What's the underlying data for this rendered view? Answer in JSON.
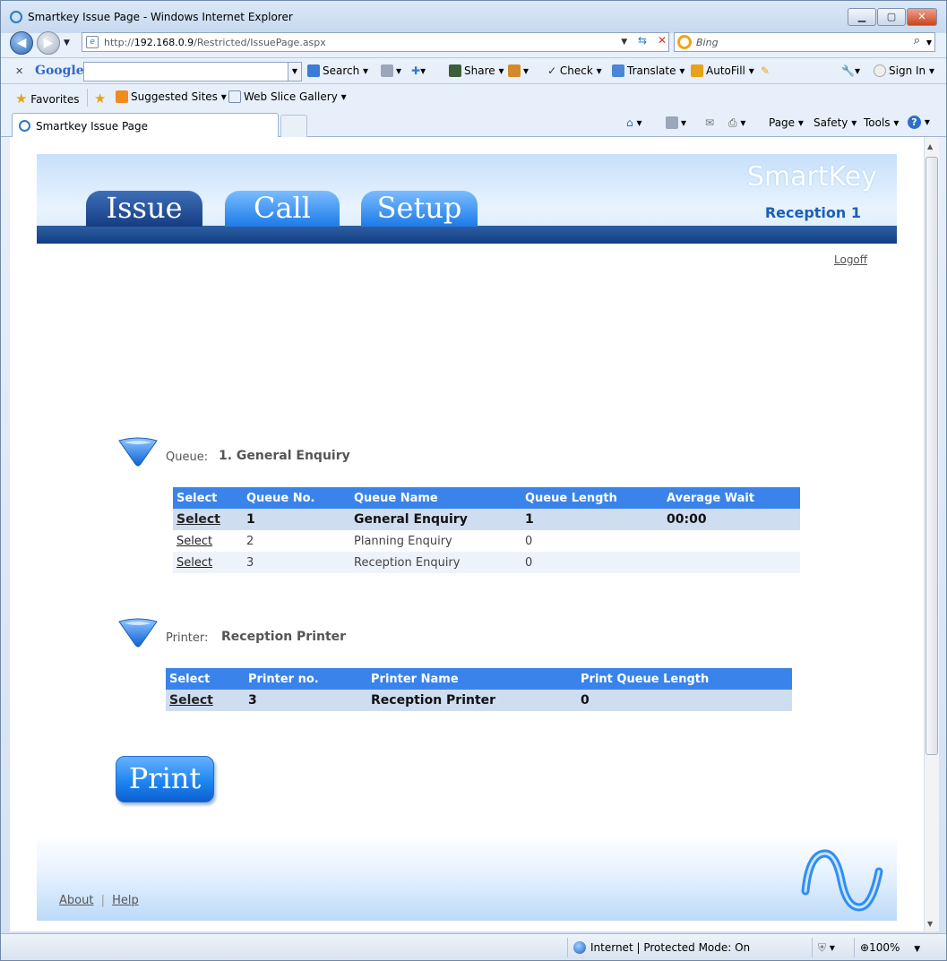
{
  "browser": {
    "window_title": "Smartkey Issue Page - Windows Internet Explorer",
    "url_prefix": "http://",
    "url_host": "192.168.0.9",
    "url_path": "/Restricted/IssuePage.aspx",
    "search_placeholder": "Bing",
    "tab_title": "Smartkey Issue Page",
    "google_toolbar": {
      "logo": "Google",
      "search": "Search",
      "share": "Share",
      "check": "Check",
      "translate": "Translate",
      "autofill": "AutoFill",
      "sign_in": "Sign In"
    },
    "favorites_bar": {
      "favorites": "Favorites",
      "suggested_sites": "Suggested Sites",
      "web_slice_gallery": "Web Slice Gallery"
    },
    "command_bar": {
      "page": "Page",
      "safety": "Safety",
      "tools": "Tools"
    },
    "status": {
      "zone": "Internet | Protected Mode: On",
      "zoom": "100%"
    }
  },
  "app": {
    "brand": "SmartKey",
    "location": "Reception 1",
    "tabs": [
      {
        "label": "Issue",
        "active": true
      },
      {
        "label": "Call",
        "active": false
      },
      {
        "label": "Setup",
        "active": false
      }
    ],
    "logoff": "Logoff",
    "queue_section": {
      "label": "Queue:",
      "value": "1. General Enquiry",
      "columns": [
        "Select",
        "Queue No.",
        "Queue Name",
        "Queue Length",
        "Average Wait"
      ],
      "rows": [
        {
          "select": "Select",
          "no": "1",
          "name": "General Enquiry",
          "length": "1",
          "wait": "00:00"
        },
        {
          "select": "Select",
          "no": "2",
          "name": "Planning Enquiry",
          "length": "0",
          "wait": ""
        },
        {
          "select": "Select",
          "no": "3",
          "name": "Reception Enquiry",
          "length": "0",
          "wait": ""
        }
      ]
    },
    "printer_section": {
      "label": "Printer:",
      "value": "Reception Printer",
      "columns": [
        "Select",
        "Printer no.",
        "Printer Name",
        "Print Queue Length"
      ],
      "rows": [
        {
          "select": "Select",
          "no": "3",
          "name": "Reception Printer",
          "length": "0"
        }
      ]
    },
    "print_button": "Print",
    "footer": {
      "about": "About",
      "separator": "|",
      "help": "Help"
    }
  }
}
